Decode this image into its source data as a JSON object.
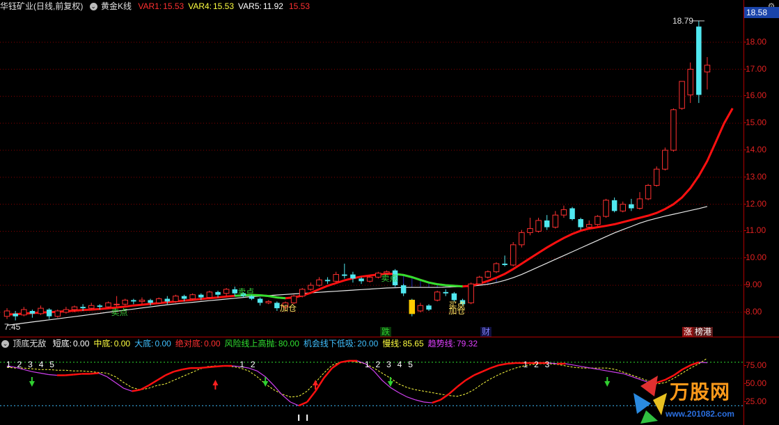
{
  "main": {
    "title": "华钰矿业(日线,前复权)",
    "title_arrow": "⌄",
    "indicator": "黄金K线",
    "vars": [
      {
        "label": "VAR1:",
        "value": "15.53",
        "color": "#ff3030"
      },
      {
        "label": "VAR4:",
        "value": "15.53",
        "color": "#ffff40"
      },
      {
        "label": "VAR5:",
        "value": "11.92",
        "color": "#ffffff"
      },
      {
        "label": "",
        "value": "15.53",
        "color": "#ff3030"
      }
    ],
    "y_ticks": [
      "18.00",
      "17.00",
      "16.00",
      "15.00",
      "14.00",
      "13.00",
      "12.00",
      "11.00",
      "10.00",
      "9.00",
      "8.00"
    ],
    "current_price": "18.58",
    "high_label": "18.79",
    "low_label": "7.45",
    "gear_icon": "gear-icon",
    "annotations": [
      {
        "text": "卖点",
        "color": "#3acf3a"
      },
      {
        "text": "卖点",
        "color": "#3acf3a"
      },
      {
        "text": "卖点",
        "color": "#3acf3a"
      },
      {
        "text": "加仓",
        "color": "#ffe060"
      },
      {
        "text": "买点",
        "color": "#ffe060"
      },
      {
        "text": "加仓",
        "color": "#ffe060"
      }
    ],
    "events": [
      {
        "text": "跌",
        "color": "#30d030",
        "bg": "#0a3a0a"
      },
      {
        "text": "财",
        "color": "#8080ff",
        "bg": "#101040"
      },
      {
        "text": "涨",
        "color": "#ffffff",
        "bg": "#8a1010"
      },
      {
        "text": "榜港",
        "color": "#ffffff",
        "bg": "#5a1a1a"
      }
    ]
  },
  "sub": {
    "name": "顶底无敌",
    "items": [
      {
        "label": "短底:",
        "value": "0.00",
        "color": "#ffffff"
      },
      {
        "label": "中底:",
        "value": "0.00",
        "color": "#ffff40"
      },
      {
        "label": "大底:",
        "value": "0.00",
        "color": "#40c0ff"
      },
      {
        "label": "绝对底:",
        "value": "0.00",
        "color": "#ff3030"
      },
      {
        "label": "风险线上高抛:",
        "value": "80.00",
        "color": "#30e030"
      },
      {
        "label": "机会线下低吸:",
        "value": "20.00",
        "color": "#40c0ff"
      },
      {
        "label": "慢线:",
        "value": "85.65",
        "color": "#ffff40"
      },
      {
        "label": "趋势线:",
        "value": "79.32",
        "color": "#e040ff"
      }
    ],
    "y_ticks": [
      "75.00",
      "50.00",
      "25.00"
    ],
    "digit_groups": [
      [
        "1",
        "2",
        "3",
        "4",
        "5"
      ],
      [
        "1",
        "2"
      ],
      [
        "1",
        "2",
        "3",
        "4",
        "5"
      ],
      [
        "1",
        "2",
        "3"
      ]
    ]
  },
  "watermark": {
    "brand": "万股网",
    "url": "www.201082.com"
  },
  "chart_data": [
    {
      "type": "candlestick",
      "title": "华钰矿业(日线,前复权)",
      "ylim": [
        7.2,
        19.1
      ],
      "y_ticks": [
        8,
        9,
        10,
        11,
        12,
        13,
        14,
        15,
        16,
        17,
        18
      ],
      "candles": [
        [
          7.85,
          8.05,
          7.75,
          8.15
        ],
        [
          7.95,
          7.85,
          7.7,
          8.05
        ],
        [
          7.9,
          8.1,
          7.85,
          8.2
        ],
        [
          8.05,
          7.95,
          7.8,
          8.1
        ],
        [
          7.95,
          8.15,
          7.9,
          8.25
        ],
        [
          8.1,
          7.85,
          7.75,
          8.15
        ],
        [
          7.85,
          8.05,
          7.8,
          8.1
        ],
        [
          8.0,
          8.1,
          7.95,
          8.2
        ],
        [
          8.1,
          8.2,
          8.0,
          8.25
        ],
        [
          8.2,
          8.15,
          8.05,
          8.3
        ],
        [
          8.15,
          8.25,
          8.1,
          8.35
        ],
        [
          8.25,
          8.2,
          8.1,
          8.3
        ],
        [
          8.2,
          8.35,
          8.15,
          8.4
        ],
        [
          8.3,
          8.3,
          8.2,
          8.6
        ],
        [
          8.3,
          8.45,
          8.25,
          8.5
        ],
        [
          8.45,
          8.4,
          8.3,
          8.5
        ],
        [
          8.4,
          8.45,
          8.3,
          8.55
        ],
        [
          8.45,
          8.35,
          8.25,
          8.5
        ],
        [
          8.35,
          8.5,
          8.3,
          8.55
        ],
        [
          8.5,
          8.4,
          8.3,
          8.6
        ],
        [
          8.4,
          8.6,
          8.35,
          8.65
        ],
        [
          8.6,
          8.5,
          8.4,
          8.65
        ],
        [
          8.5,
          8.65,
          8.45,
          8.7
        ],
        [
          8.65,
          8.55,
          8.45,
          8.7
        ],
        [
          8.55,
          8.75,
          8.5,
          8.8
        ],
        [
          8.75,
          8.65,
          8.55,
          8.8
        ],
        [
          8.7,
          8.85,
          8.6,
          8.9
        ],
        [
          8.85,
          8.7,
          8.6,
          8.95
        ],
        [
          8.7,
          8.6,
          8.55,
          8.75
        ],
        [
          8.6,
          8.5,
          8.45,
          8.65
        ],
        [
          8.5,
          8.35,
          8.25,
          8.55
        ],
        [
          8.35,
          8.4,
          8.3,
          8.45
        ],
        [
          8.35,
          8.15,
          8.05,
          8.4
        ],
        [
          8.2,
          8.35,
          8.1,
          8.4
        ],
        [
          8.35,
          8.6,
          8.3,
          8.65
        ],
        [
          8.6,
          8.85,
          8.55,
          8.9
        ],
        [
          8.85,
          9.0,
          8.8,
          9.1
        ],
        [
          9.0,
          9.2,
          8.95,
          9.3
        ],
        [
          9.2,
          9.15,
          9.05,
          9.3
        ],
        [
          9.15,
          9.4,
          9.1,
          9.5
        ],
        [
          9.4,
          9.35,
          9.25,
          9.8
        ],
        [
          9.4,
          9.25,
          9.1,
          9.5
        ],
        [
          9.25,
          9.15,
          9.05,
          9.3
        ],
        [
          9.15,
          9.3,
          9.1,
          9.35
        ],
        [
          9.3,
          9.45,
          9.25,
          9.5
        ],
        [
          9.45,
          9.5,
          9.4,
          9.55
        ],
        [
          9.55,
          9.0,
          8.95,
          9.6
        ],
        [
          9.0,
          8.7,
          8.6,
          9.05
        ],
        [
          8.45,
          7.95,
          7.85,
          8.5
        ],
        [
          8.05,
          8.25,
          8.0,
          8.35
        ],
        [
          8.25,
          8.1,
          8.05,
          8.3
        ],
        [
          8.45,
          8.75,
          8.4,
          8.8
        ],
        [
          8.75,
          8.7,
          8.6,
          8.85
        ],
        [
          8.7,
          8.45,
          8.4,
          8.75
        ],
        [
          8.45,
          8.3,
          8.25,
          8.5
        ],
        [
          8.35,
          9.05,
          8.3,
          9.1
        ],
        [
          9.05,
          9.3,
          9.0,
          9.35
        ],
        [
          9.3,
          9.5,
          9.25,
          9.55
        ],
        [
          9.5,
          9.8,
          9.45,
          9.85
        ],
        [
          9.8,
          9.75,
          9.7,
          10.1
        ],
        [
          9.75,
          10.5,
          9.7,
          10.6
        ],
        [
          10.5,
          10.95,
          10.4,
          11.05
        ],
        [
          10.95,
          11.1,
          10.85,
          11.5
        ],
        [
          11.0,
          11.4,
          10.95,
          11.5
        ],
        [
          11.4,
          11.15,
          11.05,
          11.6
        ],
        [
          11.15,
          11.6,
          11.1,
          11.75
        ],
        [
          11.6,
          11.8,
          11.5,
          11.95
        ],
        [
          11.85,
          11.45,
          11.4,
          11.9
        ],
        [
          11.45,
          11.15,
          11.05,
          11.5
        ],
        [
          11.15,
          11.25,
          11.1,
          11.4
        ],
        [
          11.25,
          11.55,
          11.2,
          11.6
        ],
        [
          11.55,
          12.15,
          11.5,
          12.2
        ],
        [
          12.15,
          11.75,
          11.7,
          12.25
        ],
        [
          11.75,
          12.0,
          11.7,
          12.1
        ],
        [
          12.0,
          11.85,
          11.75,
          12.2
        ],
        [
          11.85,
          12.2,
          11.8,
          12.45
        ],
        [
          12.2,
          12.7,
          12.15,
          12.75
        ],
        [
          12.7,
          13.3,
          12.65,
          13.4
        ],
        [
          13.3,
          14.0,
          13.25,
          14.1
        ],
        [
          14.0,
          15.5,
          13.95,
          15.55
        ],
        [
          15.55,
          16.55,
          15.5,
          16.55
        ],
        [
          16.05,
          17.0,
          15.75,
          17.25
        ],
        [
          18.58,
          16.05,
          15.75,
          18.79
        ],
        [
          16.9,
          17.15,
          16.25,
          17.45
        ]
      ],
      "ma_fast": [
        7.92,
        7.93,
        7.95,
        7.97,
        7.99,
        8.0,
        8.02,
        8.04,
        8.06,
        8.08,
        8.1,
        8.12,
        8.15,
        8.18,
        8.21,
        8.25,
        8.28,
        8.31,
        8.34,
        8.37,
        8.4,
        8.43,
        8.46,
        8.49,
        8.52,
        8.55,
        8.58,
        8.61,
        8.63,
        8.64,
        8.63,
        8.6,
        8.55,
        8.52,
        8.55,
        8.62,
        8.72,
        8.85,
        8.98,
        9.08,
        9.18,
        9.26,
        9.32,
        9.36,
        9.4,
        9.42,
        9.42,
        9.38,
        9.3,
        9.2,
        9.1,
        9.04,
        9.0,
        8.98,
        8.96,
        8.98,
        9.06,
        9.16,
        9.28,
        9.42,
        9.6,
        9.8,
        10.0,
        10.2,
        10.4,
        10.58,
        10.75,
        10.9,
        11.02,
        11.1,
        11.15,
        11.2,
        11.26,
        11.34,
        11.42,
        11.5,
        11.58,
        11.68,
        11.82,
        12.0,
        12.25,
        12.6,
        13.05,
        13.6,
        14.3,
        15.0,
        15.55
      ],
      "ma_slow": [
        7.52,
        7.56,
        7.6,
        7.64,
        7.68,
        7.72,
        7.76,
        7.8,
        7.84,
        7.88,
        7.92,
        7.96,
        8.0,
        8.04,
        8.08,
        8.12,
        8.16,
        8.2,
        8.24,
        8.28,
        8.31,
        8.34,
        8.37,
        8.4,
        8.43,
        8.46,
        8.49,
        8.52,
        8.55,
        8.58,
        8.6,
        8.62,
        8.64,
        8.66,
        8.68,
        8.7,
        8.72,
        8.74,
        8.76,
        8.78,
        8.8,
        8.82,
        8.84,
        8.86,
        8.88,
        8.9,
        8.91,
        8.92,
        8.92,
        8.92,
        8.92,
        8.92,
        8.93,
        8.94,
        8.95,
        8.97,
        9.0,
        9.04,
        9.1,
        9.18,
        9.28,
        9.4,
        9.54,
        9.68,
        9.82,
        9.96,
        10.1,
        10.24,
        10.38,
        10.52,
        10.66,
        10.8,
        10.94,
        11.06,
        11.18,
        11.3,
        11.4,
        11.48,
        11.56,
        11.63,
        11.7,
        11.77,
        11.84,
        11.92
      ]
    },
    {
      "type": "line",
      "title": "顶底无敌",
      "ylim": [
        0,
        100
      ],
      "y_ticks": [
        75,
        50,
        25
      ],
      "series": [
        {
          "name": "慢线",
          "values": [
            73,
            72,
            72,
            71,
            70,
            70,
            69,
            69,
            68,
            68,
            67,
            66,
            65,
            60,
            52,
            45,
            42,
            44,
            48,
            50,
            55,
            60,
            65,
            70,
            74,
            75,
            75,
            74,
            72,
            68,
            60,
            50,
            42,
            36,
            32,
            33,
            40,
            52,
            65,
            76,
            80,
            82,
            80,
            78,
            72,
            65,
            58,
            50,
            45,
            42,
            40,
            38,
            36,
            34,
            33,
            36,
            42,
            50,
            57,
            63,
            68,
            72,
            75,
            77,
            78,
            78,
            77,
            75,
            73,
            72,
            72,
            72,
            72,
            70,
            66,
            62,
            58,
            54,
            50,
            52,
            58,
            65,
            72,
            78,
            85.65
          ]
        },
        {
          "name": "趋势线",
          "values": [
            75,
            73,
            70,
            67,
            65,
            63,
            62,
            62,
            63,
            64,
            64,
            65,
            60,
            52,
            44,
            40,
            42,
            48,
            55,
            62,
            67,
            70,
            72,
            72,
            73,
            74,
            75,
            75,
            74,
            72,
            68,
            60,
            48,
            35,
            25,
            20,
            25,
            40,
            58,
            72,
            80,
            82,
            82,
            78,
            68,
            55,
            45,
            38,
            32,
            28,
            25,
            24,
            28,
            36,
            46,
            55,
            62,
            67,
            72,
            76,
            78,
            79,
            79,
            79,
            79,
            79,
            78,
            78,
            76,
            74,
            72,
            70,
            68,
            66,
            64,
            60,
            56,
            52,
            52,
            56,
            62,
            70,
            76,
            80,
            79.32
          ]
        },
        {
          "name": "风险线上高抛",
          "values": [
            80
          ]
        },
        {
          "name": "机会线下低吸",
          "values": [
            20
          ]
        }
      ]
    }
  ]
}
